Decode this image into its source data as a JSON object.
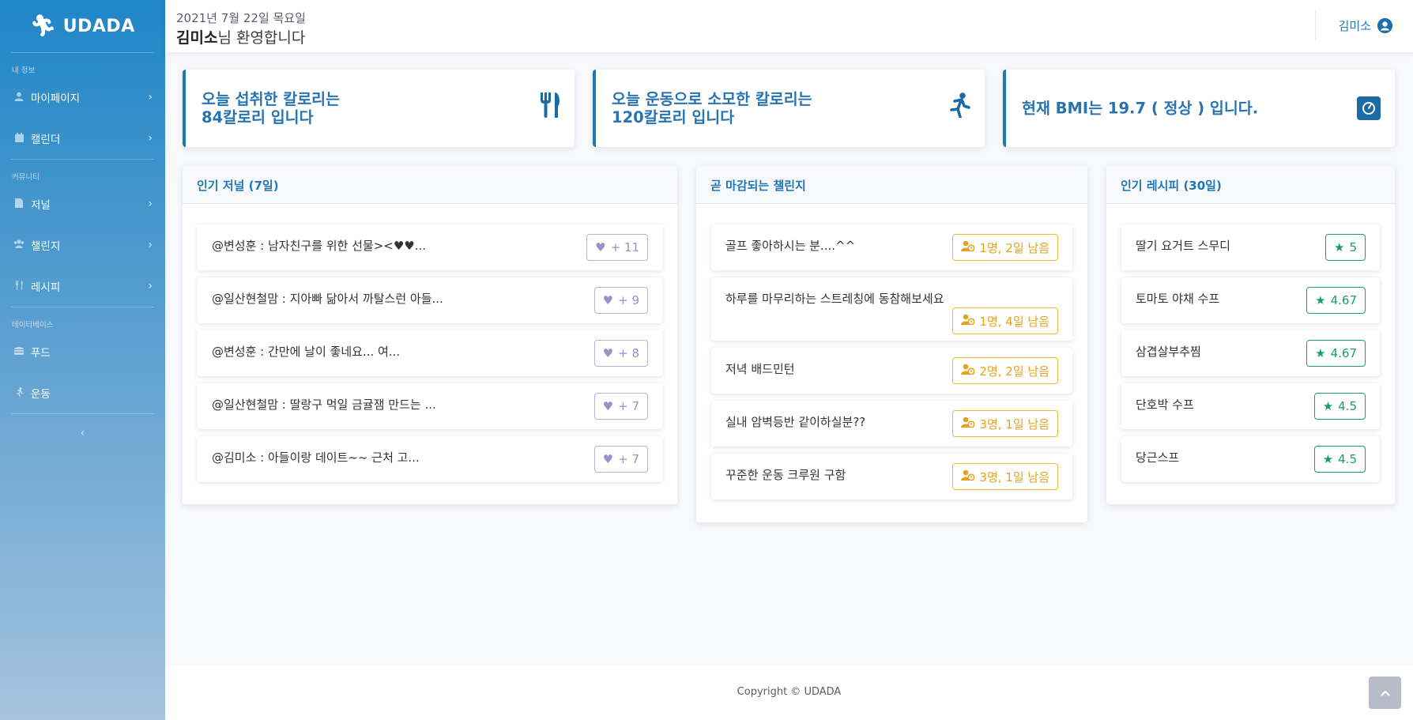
{
  "brand": {
    "name": "UDADA",
    "logo_icon": "running-person-icon"
  },
  "sidebar": {
    "sections": [
      {
        "heading": "내 정보",
        "items": [
          {
            "label": "마이페이지",
            "icon": "user-icon"
          },
          {
            "label": "캘린더",
            "icon": "calendar-icon"
          }
        ]
      },
      {
        "heading": "커뮤니티",
        "items": [
          {
            "label": "저널",
            "icon": "file-icon"
          },
          {
            "label": "챌린지",
            "icon": "users-icon"
          },
          {
            "label": "레시피",
            "icon": "utensils-icon"
          }
        ]
      },
      {
        "heading": "데이터베이스",
        "items": [
          {
            "label": "푸드",
            "icon": "hamburger-icon"
          },
          {
            "label": "운동",
            "icon": "running-icon"
          }
        ]
      }
    ],
    "toggle_icon": "chevron-left-icon"
  },
  "header": {
    "date": "2021년 7월 22일 목요일",
    "user_name": "김미소",
    "welcome_suffix": "님 환영합니다",
    "account_name": "김미소"
  },
  "stats": [
    {
      "line1": "오늘 섭취한 칼로리는",
      "line2": "84칼로리 입니다",
      "icon": "utensils-icon"
    },
    {
      "line1": "오늘 운동으로 소모한 칼로리는",
      "line2": "120칼로리 입니다",
      "icon": "running-icon"
    },
    {
      "line1": "현재 BMI는 19.7 ( 정상 ) 입니다.",
      "line2": "",
      "icon": "weight-scale-icon"
    }
  ],
  "journals": {
    "title": "인기 저널 (7일)",
    "items": [
      {
        "text": "@변성훈 : 남자친구를 위한 선물><♥♥...",
        "likes": "+ 11"
      },
      {
        "text": "@일산현철맘 : 지아빠 닮아서 까탈스런 아들...",
        "likes": "+ 9"
      },
      {
        "text": "@변성훈 : 간만에 날이 좋네요... 여...",
        "likes": "+ 8"
      },
      {
        "text": "@일산현철맘 : 딸랑구 먹일 금귤잼 만드는 ...",
        "likes": "+ 7"
      },
      {
        "text": "@김미소 : 아들이랑 데이트~~ 근처 고...",
        "likes": "+ 7"
      }
    ]
  },
  "challenges": {
    "title": "곧 마감되는 챌린지",
    "items": [
      {
        "text": "골프 좋아하시는 분....^^",
        "status": "1명, 2일 남음"
      },
      {
        "text": "하루를 마무리하는 스트레칭에 동참해보세요",
        "status": "1명, 4일 남음"
      },
      {
        "text": "저녁 배드민턴",
        "status": "2명, 2일 남음"
      },
      {
        "text": "실내 암벽등반 같이하실분??",
        "status": "3명, 1일 남음"
      },
      {
        "text": "꾸준한 운동 크루원 구함",
        "status": "3명, 1일 남음"
      }
    ]
  },
  "recipes": {
    "title": "인기 레시피 (30일)",
    "items": [
      {
        "text": "딸기 요거트 스무디",
        "rating": "5"
      },
      {
        "text": "토마토 야채 수프",
        "rating": "4.67"
      },
      {
        "text": "삼겹살부추찜",
        "rating": "4.67"
      },
      {
        "text": "단호박 수프",
        "rating": "4.5"
      },
      {
        "text": "당근스프",
        "rating": "4.5"
      }
    ]
  },
  "footer": {
    "copyright": "Copyright © UDADA"
  },
  "colors": {
    "primary": "#1f78b4",
    "like": "#9b91c6",
    "deadline": "#e3a31b",
    "star": "#1a9b74"
  }
}
